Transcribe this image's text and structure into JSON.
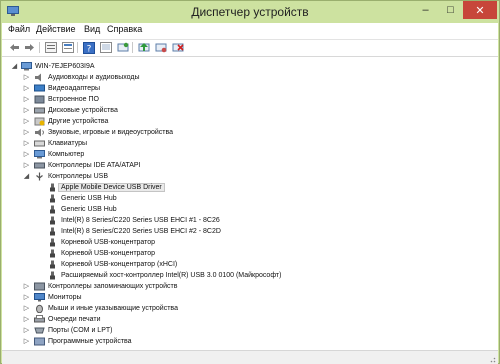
{
  "window": {
    "title": "Диспетчер устройств",
    "accent": "#cfe3a0",
    "close_color": "#c7463a"
  },
  "title_buttons": {
    "minimize": "–",
    "maximize": "□",
    "close": "✕"
  },
  "menu": [
    {
      "label": "Файл"
    },
    {
      "label": "Действие"
    },
    {
      "label": "Вид"
    },
    {
      "label": "Справка"
    }
  ],
  "toolbar": {
    "buttons": [
      "back-icon",
      "forward-icon",
      "device-view-icon",
      "properties-icon",
      "help-icon",
      "scan-icon",
      "update-driver-icon",
      "enable-icon",
      "uninstall-icon"
    ]
  },
  "tree": {
    "root": "WIN-7EJEP603I9A",
    "categories": [
      {
        "label": "Аудиовходы и аудиовыходы",
        "icon": "audio-icon"
      },
      {
        "label": "Видеоадаптеры",
        "icon": "display-adapter-icon"
      },
      {
        "label": "Встроенное ПО",
        "icon": "firmware-icon"
      },
      {
        "label": "Дисковые устройства",
        "icon": "disk-icon"
      },
      {
        "label": "Другие устройства",
        "icon": "other-device-icon"
      },
      {
        "label": "Звуковые, игровые и видеоустройства",
        "icon": "sound-icon"
      },
      {
        "label": "Клавиатуры",
        "icon": "keyboard-icon"
      },
      {
        "label": "Компьютер",
        "icon": "computer-icon"
      },
      {
        "label": "Контроллеры IDE ATA/ATAPI",
        "icon": "ide-icon"
      },
      {
        "label": "Контроллеры USB",
        "icon": "usb-icon"
      }
    ],
    "usb_children": [
      "Apple Mobile Device USB Driver",
      "Generic USB Hub",
      "Generic USB Hub",
      "Intel(R) 8 Series/C220 Series USB EHCI #1 - 8C26",
      "Intel(R) 8 Series/C220 Series USB EHCI #2 - 8C2D",
      "Корневой USB-концентратор",
      "Корневой USB-концентратор",
      "Корневой USB-концентратор (xHCI)",
      "Расширяемый хост-контроллер Intel(R) USB 3.0 0100 (Майкрософт)"
    ],
    "selected_child": "Apple Mobile Device USB Driver",
    "categories_after": [
      {
        "label": "Контроллеры запоминающих устройств",
        "icon": "storage-controller-icon"
      },
      {
        "label": "Мониторы",
        "icon": "monitor-icon"
      },
      {
        "label": "Мыши и иные указывающие устройства",
        "icon": "mouse-icon"
      },
      {
        "label": "Очереди печати",
        "icon": "print-queue-icon"
      },
      {
        "label": "Порты (COM и LPT)",
        "icon": "port-icon"
      },
      {
        "label": "Программные устройства",
        "icon": "software-device-icon"
      }
    ]
  }
}
